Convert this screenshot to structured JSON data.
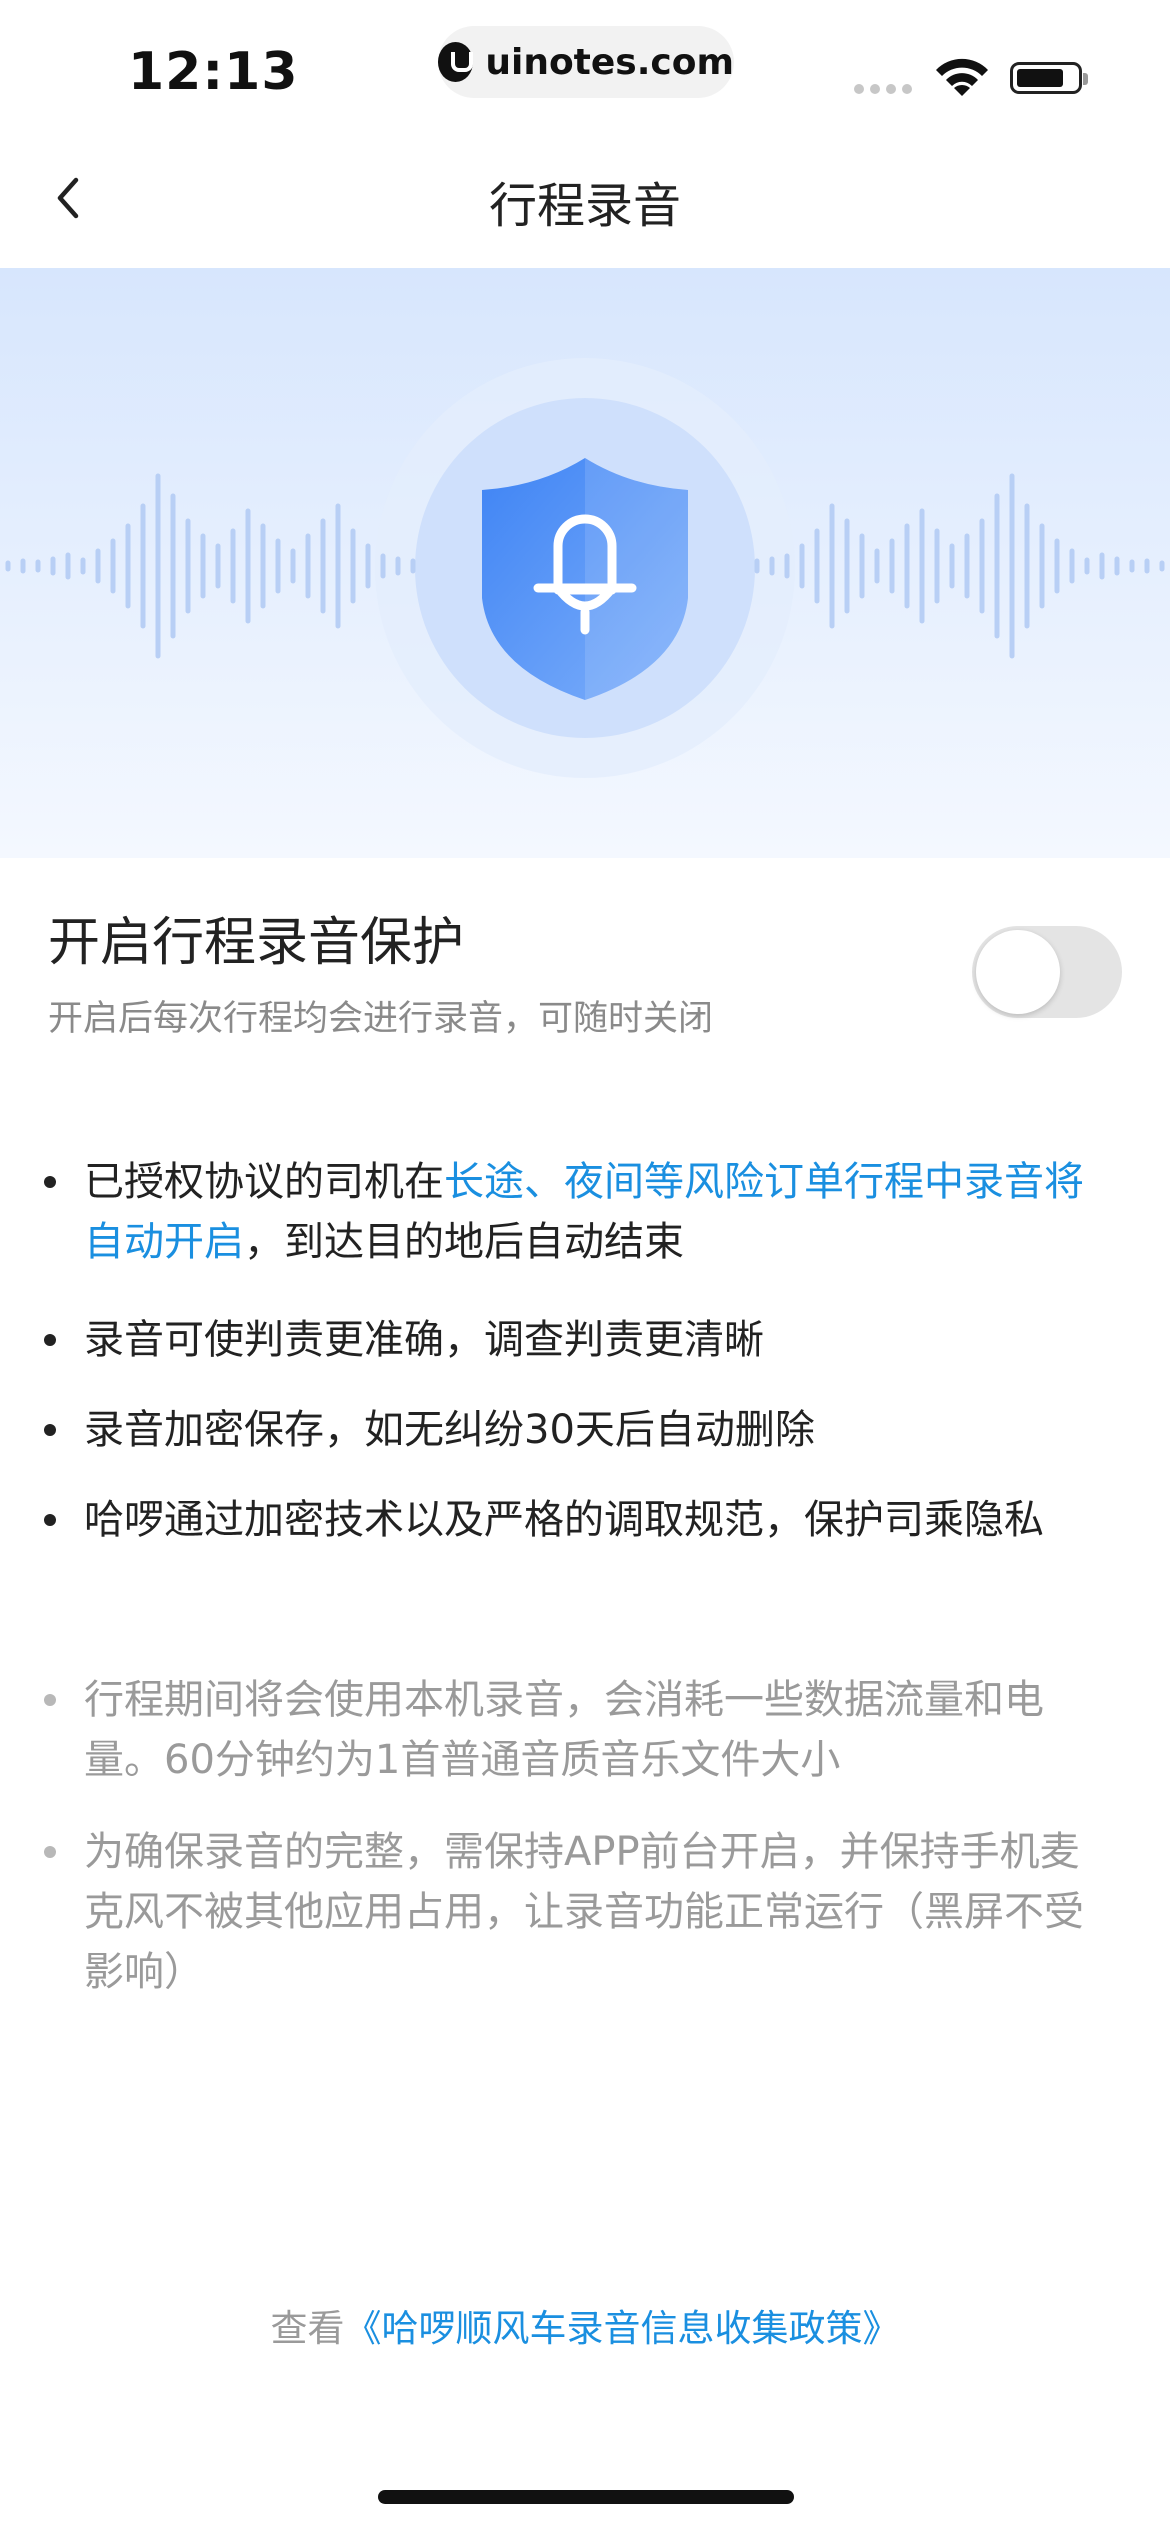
{
  "status_bar": {
    "time": "12:13",
    "url": "uinotes.com"
  },
  "nav": {
    "title": "行程录音"
  },
  "toggle": {
    "title": "开启行程录音保护",
    "subtitle": "开启后每次行程均会进行录音，可随时关闭",
    "enabled": false
  },
  "bullets": [
    {
      "pre": "已授权协议的司机在",
      "highlight": "长途、夜间等风险订单行程中录音将自动开启",
      "post": "，到达目的地后自动结束"
    },
    {
      "text": "录音可使判责更准确，调查判责更清晰"
    },
    {
      "text": "录音加密保存，如无纠纷30天后自动删除"
    },
    {
      "text": "哈啰通过加密技术以及严格的调取规范，保护司乘隐私"
    }
  ],
  "notes": [
    {
      "text": "行程期间将会使用本机录音，会消耗一些数据流量和电量。60分钟约为1首普通音质音乐文件大小"
    },
    {
      "text": "为确保录音的完整，需保持APP前台开启，并保持手机麦克风不被其他应用占用，让录音功能正常运行（黑屏不受影响）"
    }
  ],
  "footer": {
    "prefix": "查看",
    "link": "《哈啰顺风车录音信息收集政策》"
  },
  "colors": {
    "accent": "#1a8fe0",
    "shield": "#4a8cf5",
    "hero_bg": "#dbe8fd"
  },
  "icons": {
    "back": "chevron-left-icon",
    "hero": "shield-microphone-icon"
  }
}
